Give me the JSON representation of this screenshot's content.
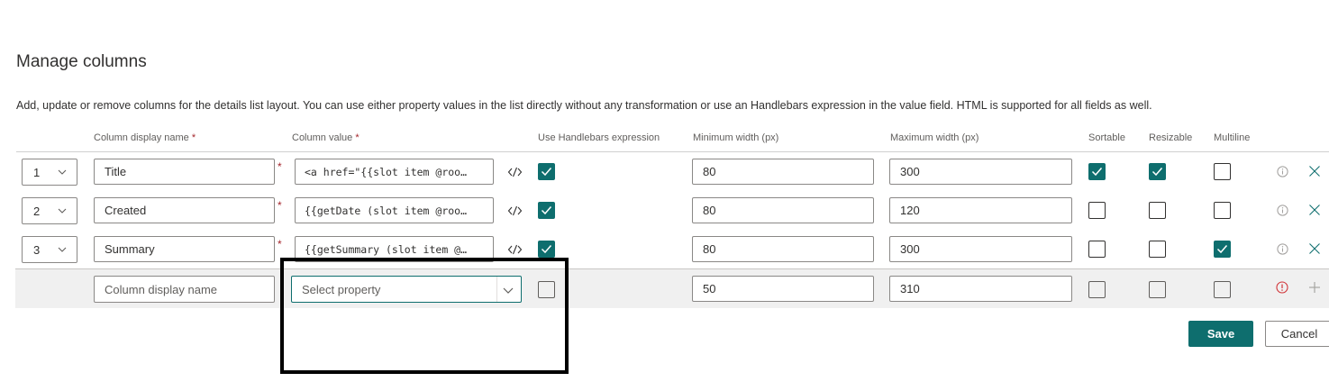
{
  "page": {
    "title": "Manage columns",
    "description": "Add, update or remove columns for the details list layout. You can use either property values in the list directly without any transformation or use an Handlebars expression in the value field. HTML is supported for all fields as well."
  },
  "headers": {
    "display_name": "Column display name",
    "value": "Column value",
    "handlebars": "Use Handlebars expression",
    "min_width": "Minimum width (px)",
    "max_width": "Maximum width (px)",
    "sortable": "Sortable",
    "resizable": "Resizable",
    "multiline": "Multiline",
    "required_mark": "*"
  },
  "rows": [
    {
      "order": "1",
      "name": "Title",
      "value": "<a href=\"{{slot item @roo…",
      "handlebars": true,
      "min": "80",
      "max": "300",
      "sortable": true,
      "resizable": true,
      "multiline": false
    },
    {
      "order": "2",
      "name": "Created",
      "value": "{{getDate (slot item @roo…",
      "handlebars": true,
      "min": "80",
      "max": "120",
      "sortable": false,
      "resizable": false,
      "multiline": false
    },
    {
      "order": "3",
      "name": "Summary",
      "value": "{{getSummary (slot item @…",
      "handlebars": true,
      "min": "80",
      "max": "300",
      "sortable": false,
      "resizable": false,
      "multiline": true
    }
  ],
  "new_row": {
    "name_placeholder": "Column display name",
    "value_placeholder": "Select property",
    "min": "50",
    "max": "310"
  },
  "buttons": {
    "save": "Save",
    "cancel": "Cancel"
  },
  "colors": {
    "accent": "#0e6e6e",
    "required": "#a4262c",
    "error": "#d13438"
  }
}
